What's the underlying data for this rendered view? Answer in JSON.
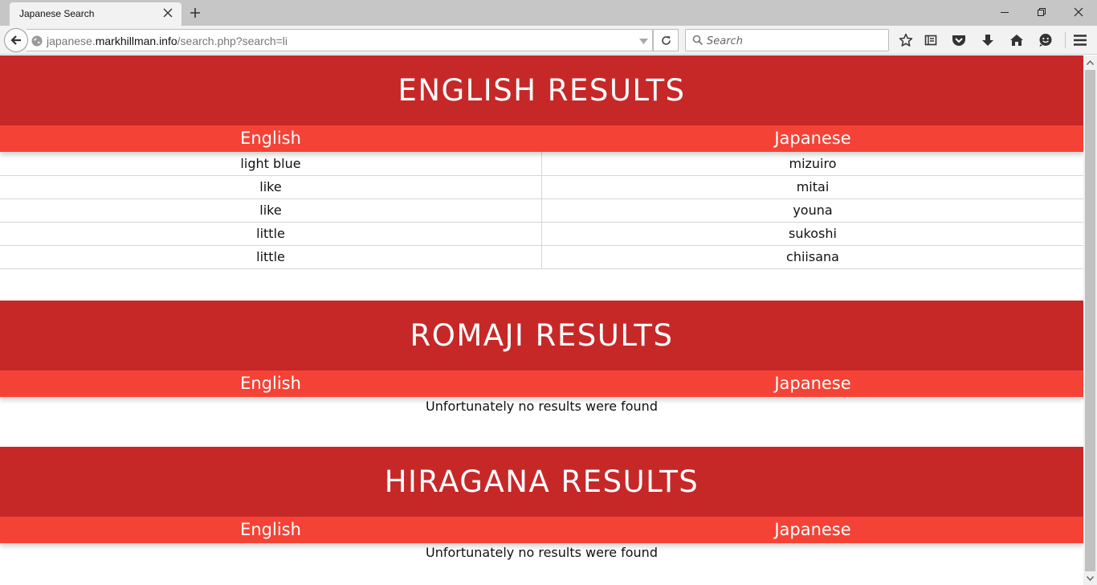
{
  "browser": {
    "tab_title": "Japanese Search",
    "url_prefix": "japanese.",
    "url_host": "markhillman.info",
    "url_path": "/search.php?search=li",
    "search_placeholder": "Search"
  },
  "sections": {
    "english": {
      "title": "ENGLISH RESULTS",
      "col_english": "English",
      "col_japanese": "Japanese",
      "rows": [
        {
          "english": "light blue",
          "japanese": "mizuiro"
        },
        {
          "english": "like",
          "japanese": "mitai"
        },
        {
          "english": "like",
          "japanese": "youna"
        },
        {
          "english": "little",
          "japanese": "sukoshi"
        },
        {
          "english": "little",
          "japanese": "chiisana"
        }
      ]
    },
    "romaji": {
      "title": "ROMAJI RESULTS",
      "col_english": "English",
      "col_japanese": "Japanese",
      "message": "Unfortunately no results were found"
    },
    "hiragana": {
      "title": "HIRAGANA RESULTS",
      "col_english": "English",
      "col_japanese": "Japanese",
      "message": "Unfortunately no results were found"
    }
  },
  "colors": {
    "header_red": "#c62828",
    "column_red": "#f44336"
  }
}
